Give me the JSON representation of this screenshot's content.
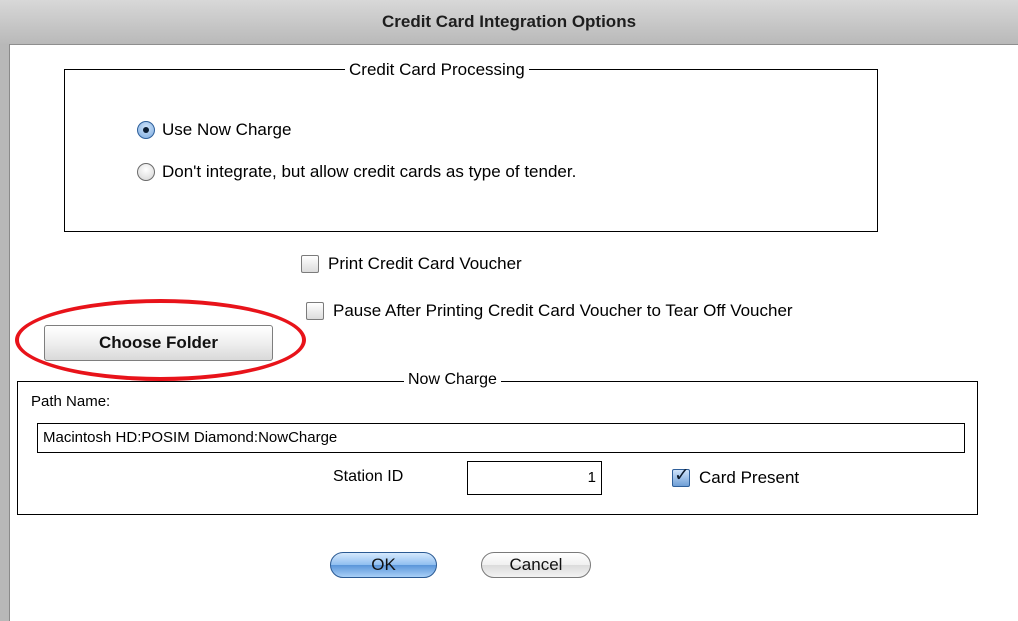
{
  "window": {
    "title": "Credit Card Integration Options"
  },
  "processing": {
    "title": "Credit Card Processing",
    "options": [
      {
        "label": "Use Now Charge",
        "selected": true
      },
      {
        "label": "Don't integrate,  but allow credit cards as type of tender.",
        "selected": false
      }
    ]
  },
  "voucher": {
    "print_label": "Print Credit Card Voucher",
    "print_checked": false,
    "pause_label": "Pause After Printing Credit Card Voucher to Tear Off Voucher",
    "pause_checked": false
  },
  "choose_folder_label": "Choose Folder",
  "annotation_color": "#e8131a",
  "now_charge": {
    "title": "Now Charge",
    "path_label": "Path Name:",
    "path_value": "Macintosh HD:POSIM Diamond:NowCharge",
    "station_label": "Station ID",
    "station_value": "1",
    "card_present_label": "Card Present",
    "card_present_checked": true
  },
  "buttons": {
    "ok": "OK",
    "cancel": "Cancel"
  }
}
